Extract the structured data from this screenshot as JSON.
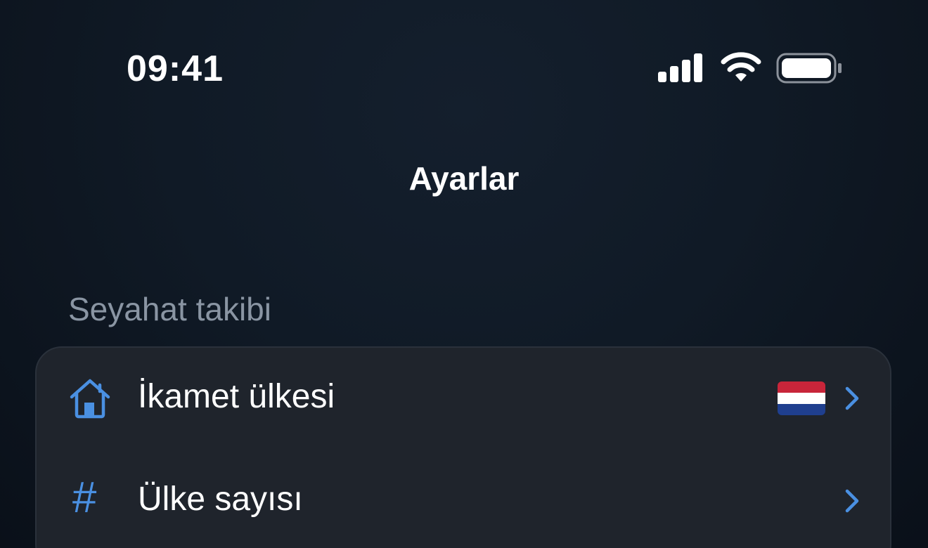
{
  "status_bar": {
    "time": "09:41",
    "signal_icon": "cellular-signal-icon",
    "wifi_icon": "wifi-icon",
    "battery_icon": "battery-icon"
  },
  "nav": {
    "title": "Ayarlar"
  },
  "section": {
    "header": "Seyahat takibi",
    "rows": [
      {
        "icon": "house-icon",
        "label": "İkamet ülkesi",
        "value_icon": "netherlands-flag-icon",
        "accessory": "chevron-right-icon"
      },
      {
        "icon": "hash-icon",
        "icon_glyph": "#",
        "label": "Ülke sayısı",
        "accessory": "chevron-right-icon"
      }
    ]
  },
  "colors": {
    "accent": "#4a90e2",
    "background": "#101a26",
    "card": "#1f242c",
    "secondary_text": "#8a95a3",
    "flag_red": "#c8253a",
    "flag_white": "#ffffff",
    "flag_blue": "#1f3f8f"
  }
}
